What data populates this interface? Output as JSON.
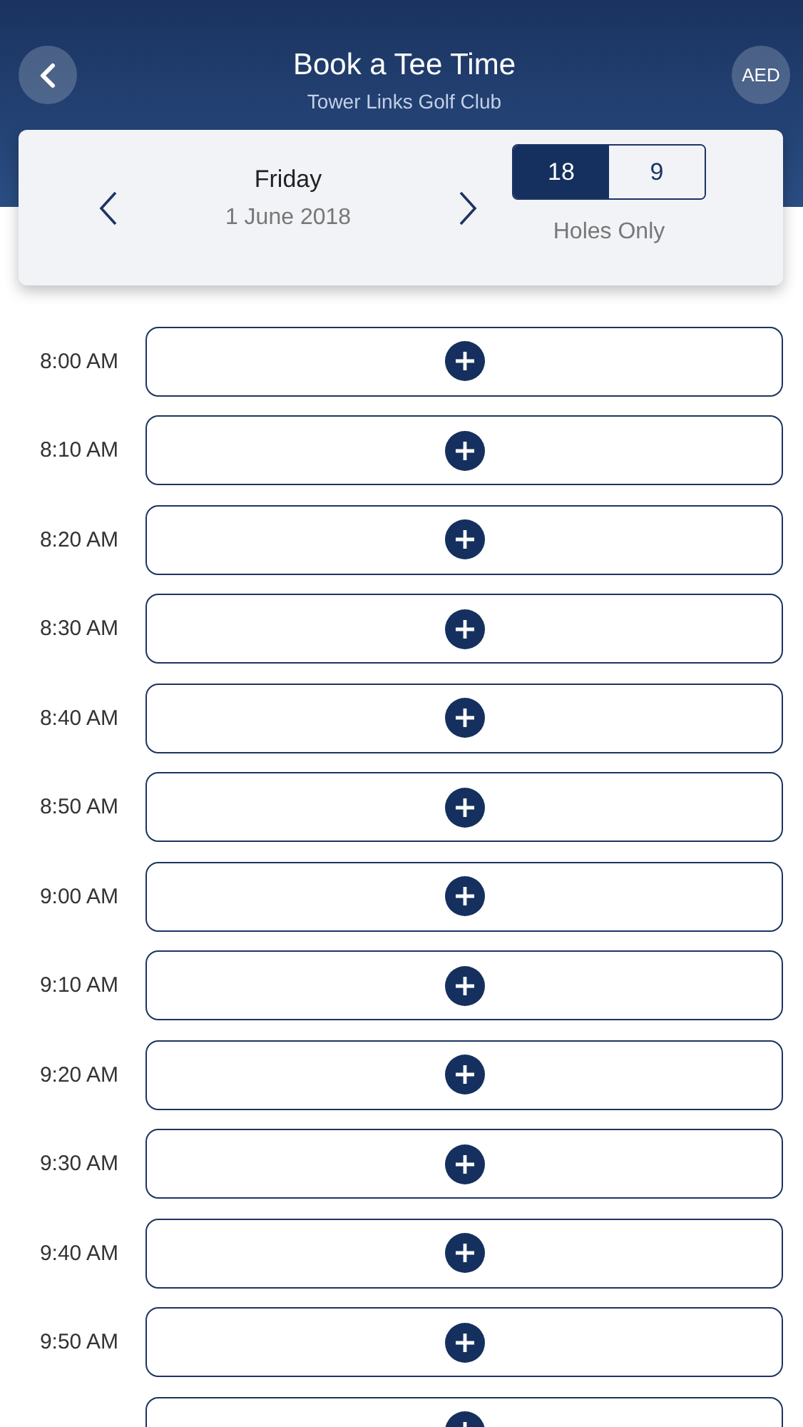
{
  "header": {
    "title": "Book a Tee Time",
    "subtitle": "Tower Links Golf Club",
    "currency": "AED"
  },
  "date": {
    "day": "Friday",
    "date": "1 June 2018"
  },
  "holes": {
    "options": [
      {
        "label": "18",
        "selected": true
      },
      {
        "label": "9",
        "selected": false
      }
    ],
    "caption": "Holes Only"
  },
  "slots": [
    {
      "time": "8:00 AM"
    },
    {
      "time": "8:10 AM"
    },
    {
      "time": "8:20 AM"
    },
    {
      "time": "8:30 AM"
    },
    {
      "time": "8:40 AM"
    },
    {
      "time": "8:50 AM"
    },
    {
      "time": "9:00 AM"
    },
    {
      "time": "9:10 AM"
    },
    {
      "time": "9:20 AM"
    },
    {
      "time": "9:30 AM"
    },
    {
      "time": "9:40 AM"
    },
    {
      "time": "9:50 AM"
    }
  ],
  "next_slot_partly_shown": true
}
